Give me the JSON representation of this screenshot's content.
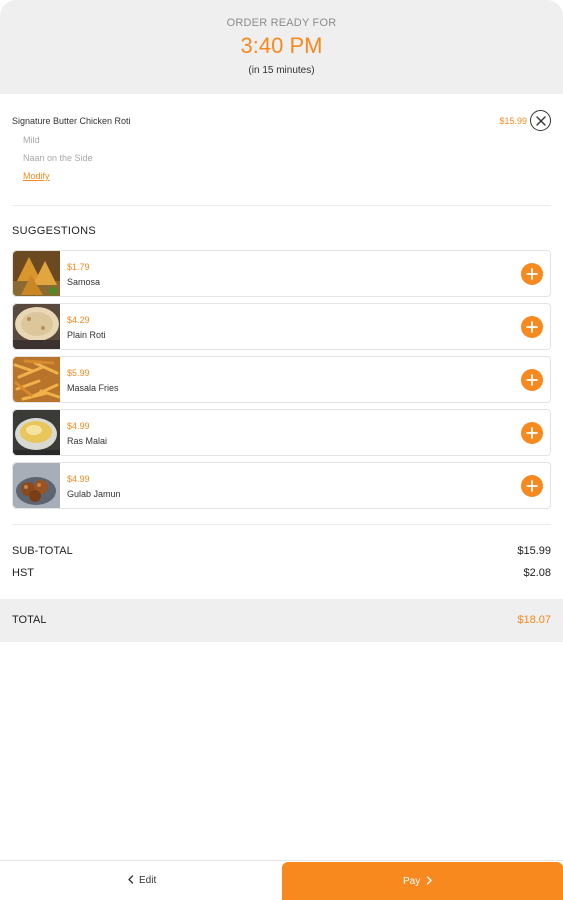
{
  "header": {
    "label": "ORDER READY FOR",
    "time": "3:40 PM",
    "sub": "(in 15 minutes)"
  },
  "order": {
    "item_name": "Signature Butter Chicken Roti",
    "modifier_1": "Mild",
    "modifier_2": "Naan on the Side",
    "modify_label": "Modify",
    "price": "$15.99"
  },
  "suggestions": {
    "title": "SUGGESTIONS",
    "items": [
      {
        "price": "$1.79",
        "name": "Samosa"
      },
      {
        "price": "$4.29",
        "name": "Plain Roti"
      },
      {
        "price": "$5.99",
        "name": "Masala Fries"
      },
      {
        "price": "$4.99",
        "name": "Ras Malai"
      },
      {
        "price": "$4.99",
        "name": "Gulab Jamun"
      }
    ]
  },
  "totals": {
    "subtotal_label": "SUB-TOTAL",
    "subtotal_value": "$15.99",
    "hst_label": "HST",
    "hst_value": "$2.08",
    "total_label": "TOTAL",
    "total_value": "$18.07"
  },
  "footer": {
    "edit_label": "Edit",
    "pay_label": "Pay"
  },
  "colors": {
    "accent": "#f7891e",
    "header_bg": "#efefef"
  },
  "icons": {
    "remove": "close-circle-icon",
    "add": "plus-circle-icon",
    "back": "chevron-left-icon",
    "forward": "chevron-right-icon"
  }
}
